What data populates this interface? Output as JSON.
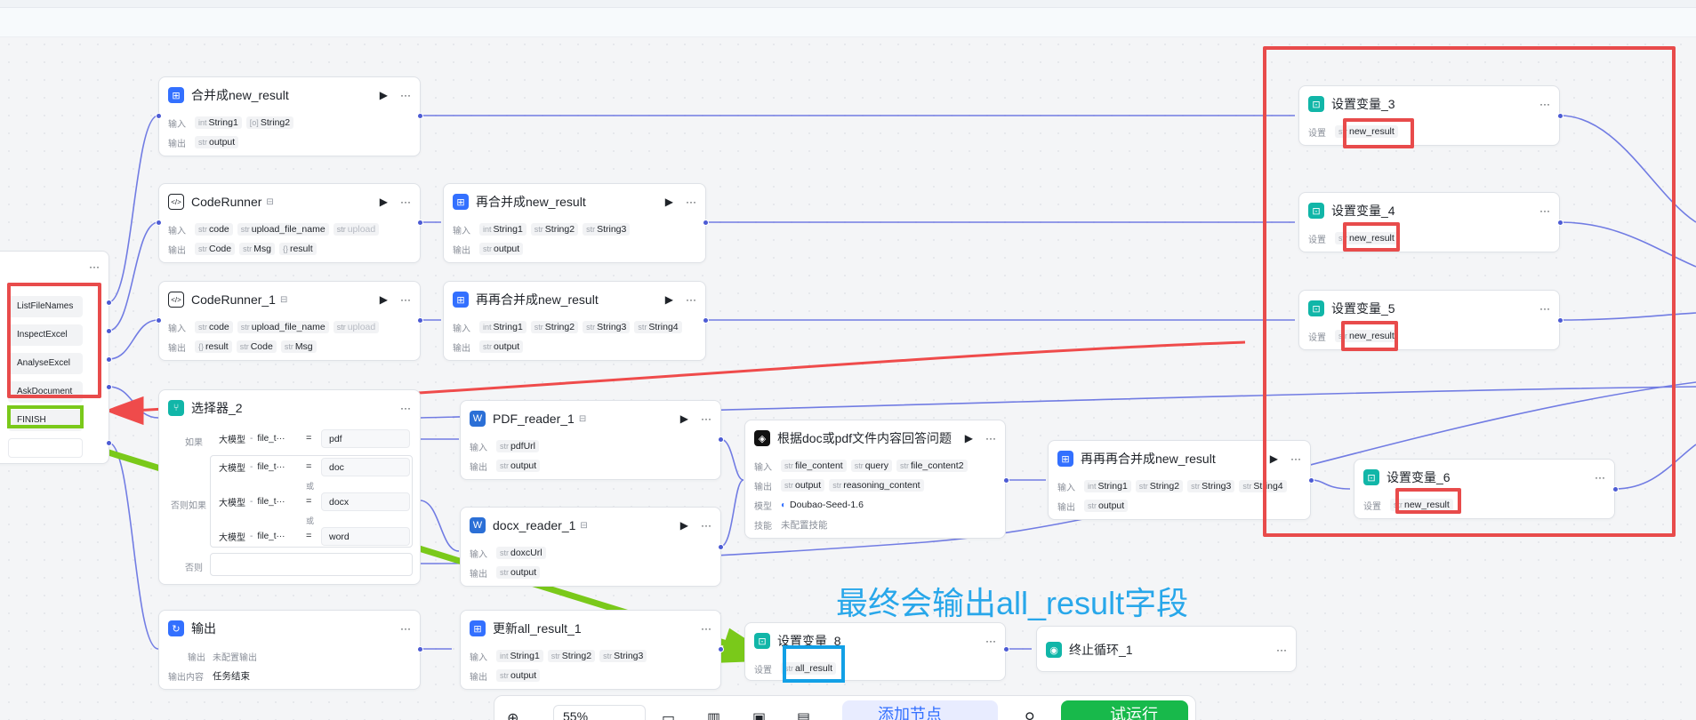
{
  "canvas": {
    "colors": {
      "wire": "#5b67e0",
      "red_annot": "#e84b4b",
      "green_annot": "#7ac91a",
      "blue_annot": "#12a0e6"
    }
  },
  "intent_node": {
    "items": [
      "ListFileNames",
      "InspectExcel",
      "AnalyseExcel",
      "AskDocument",
      "FINISH"
    ]
  },
  "nodes": {
    "merge": {
      "title": "合并成new_result",
      "in_label": "输入",
      "out_label": "输出",
      "inputs": [
        {
          "t": "int",
          "n": "String1"
        },
        {
          "t": "[o]",
          "n": "String2"
        }
      ],
      "outputs": [
        {
          "t": "str",
          "n": "output"
        }
      ]
    },
    "coderunner": {
      "title": "CodeRunner",
      "inputs": [
        {
          "t": "str",
          "n": "code"
        },
        {
          "t": "str",
          "n": "upload_file_name"
        },
        {
          "t": "str",
          "n": "upload"
        }
      ],
      "outputs": [
        {
          "t": "str",
          "n": "Code"
        },
        {
          "t": "str",
          "n": "Msg"
        },
        {
          "t": "{}",
          "n": "result"
        }
      ]
    },
    "coderunner1": {
      "title": "CodeRunner_1",
      "inputs": [
        {
          "t": "str",
          "n": "code"
        },
        {
          "t": "str",
          "n": "upload_file_name"
        },
        {
          "t": "str",
          "n": "upload"
        }
      ],
      "outputs": [
        {
          "t": "{}",
          "n": "result"
        },
        {
          "t": "str",
          "n": "Code"
        },
        {
          "t": "str",
          "n": "Msg"
        }
      ]
    },
    "remerge": {
      "title": "再合并成new_result",
      "inputs": [
        {
          "t": "int",
          "n": "String1"
        },
        {
          "t": "str",
          "n": "String2"
        },
        {
          "t": "str",
          "n": "String3"
        }
      ],
      "outputs": [
        {
          "t": "str",
          "n": "output"
        }
      ]
    },
    "reremerge": {
      "title": "再再合并成new_result",
      "inputs": [
        {
          "t": "int",
          "n": "String1"
        },
        {
          "t": "str",
          "n": "String2"
        },
        {
          "t": "str",
          "n": "String3"
        },
        {
          "t": "str",
          "n": "String4"
        }
      ],
      "outputs": [
        {
          "t": "str",
          "n": "output"
        }
      ]
    },
    "selector": {
      "title": "选择器_2",
      "if_label": "如果",
      "elif_label": "否则如果",
      "else_label": "否则",
      "or_label": "或",
      "cond_left": "大模型",
      "cond_mid": "file_t···",
      "eq": "=",
      "values": [
        "pdf",
        "doc",
        "docx",
        "word"
      ]
    },
    "pdf": {
      "title": "PDF_reader_1",
      "inputs": [
        {
          "t": "str",
          "n": "pdfUrl"
        }
      ],
      "outputs": [
        {
          "t": "str",
          "n": "output"
        }
      ]
    },
    "docx": {
      "title": "docx_reader_1",
      "inputs": [
        {
          "t": "str",
          "n": "doxcUrl"
        }
      ],
      "outputs": [
        {
          "t": "str",
          "n": "output"
        }
      ]
    },
    "llm": {
      "title": "根据doc或pdf文件内容回答问题",
      "inputs": [
        {
          "t": "str",
          "n": "file_content"
        },
        {
          "t": "str",
          "n": "query"
        },
        {
          "t": "str",
          "n": "file_content2"
        }
      ],
      "outputs": [
        {
          "t": "str",
          "n": "output"
        },
        {
          "t": "str",
          "n": "reasoning_content"
        }
      ],
      "model_label": "模型",
      "model": "Doubao-Seed-1.6",
      "skill_label": "技能",
      "skill": "未配置技能"
    },
    "rrrmerge": {
      "title": "再再再合并成new_result",
      "inputs": [
        {
          "t": "int",
          "n": "String1"
        },
        {
          "t": "str",
          "n": "String2"
        },
        {
          "t": "str",
          "n": "String3"
        },
        {
          "t": "str",
          "n": "String4"
        }
      ],
      "outputs": [
        {
          "t": "str",
          "n": "output"
        }
      ]
    },
    "set3": {
      "title": "设置变量_3",
      "set_label": "设置",
      "var": "new_result"
    },
    "set4": {
      "title": "设置变量_4",
      "set_label": "设置",
      "var": "new_result"
    },
    "set5": {
      "title": "设置变量_5",
      "set_label": "设置",
      "var": "new_result"
    },
    "set6": {
      "title": "设置变量_6",
      "set_label": "设置",
      "var": "new_result"
    },
    "set8": {
      "title": "设置变量_8",
      "set_label": "设置",
      "var": "all_result"
    },
    "output": {
      "title": "输出",
      "out_label": "输出",
      "out_value": "未配置输出",
      "content_label": "输出内容",
      "content": "任务结束"
    },
    "update_all": {
      "title": "更新all_result_1",
      "inputs": [
        {
          "t": "int",
          "n": "String1"
        },
        {
          "t": "str",
          "n": "String2"
        },
        {
          "t": "str",
          "n": "String3"
        }
      ],
      "outputs": [
        {
          "t": "str",
          "n": "output"
        }
      ]
    },
    "stop": {
      "title": "终止循环_1"
    }
  },
  "labels": {
    "in": "输入",
    "out": "输出",
    "more": "···",
    "play": "▶"
  },
  "annotation": "最终会输出all_result字段",
  "toolbar": {
    "zoom": "55%",
    "add_node": "添加节点",
    "run": "试运行"
  }
}
